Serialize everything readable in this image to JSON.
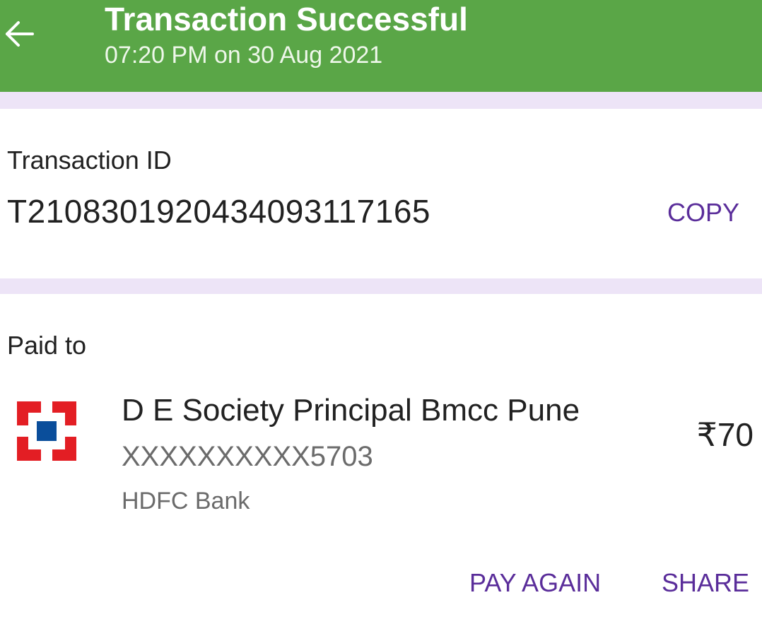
{
  "header": {
    "title": "Transaction Successful",
    "subtitle": "07:20 PM on 30 Aug 2021",
    "back_icon": "arrow-left-icon",
    "background_color": "#5aa647"
  },
  "transaction": {
    "label": "Transaction ID",
    "id": "T2108301920434093117165",
    "copy_label": "COPY"
  },
  "payment": {
    "label": "Paid to",
    "payee_name": "D E Society Principal Bmcc Pune",
    "account_number": "XXXXXXXXXX5703",
    "bank_name": "HDFC Bank",
    "bank_logo_icon": "hdfc-bank-logo",
    "amount": "₹70"
  },
  "actions": {
    "pay_again_label": "PAY AGAIN",
    "share_label": "SHARE",
    "accent_color": "#5a2d9a"
  }
}
